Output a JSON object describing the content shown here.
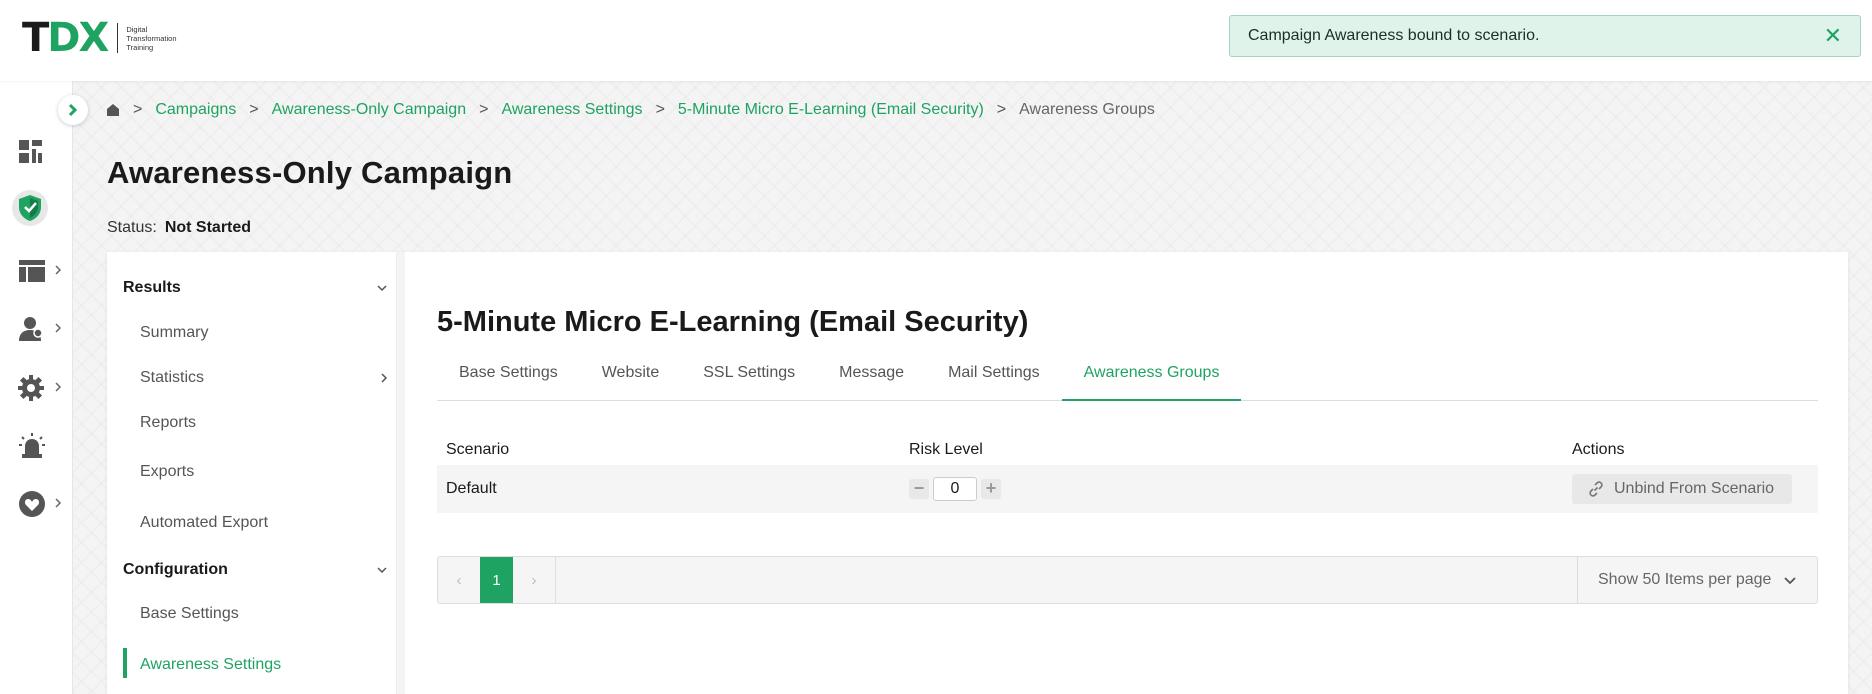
{
  "header": {
    "logo": {
      "mark_t": "T",
      "mark_dx": "DX",
      "subtitle": "Digital Transformation Training"
    },
    "toast": {
      "message": "Campaign Awareness bound to scenario.",
      "close_icon": "close-icon"
    }
  },
  "rail": {
    "items": [
      "dashboard-icon",
      "shield-icon",
      "layout-icon",
      "users-icon",
      "gear-icon",
      "alarm-icon",
      "heart-icon"
    ]
  },
  "breadcrumb": {
    "home_icon": "home-icon",
    "separator": ">",
    "items": [
      "Campaigns",
      "Awareness-Only Campaign",
      "Awareness Settings",
      "5-Minute Micro E-Learning (Email Security)",
      "Awareness Groups"
    ]
  },
  "page": {
    "title": "Awareness-Only Campaign",
    "status_label": "Status:",
    "status_value": "Not Started"
  },
  "subnav": {
    "results": "Results",
    "summary": "Summary",
    "statistics": "Statistics",
    "reports": "Reports",
    "exports": "Exports",
    "automated_export": "Automated Export",
    "configuration": "Configuration",
    "base_settings": "Base Settings",
    "awareness_settings": "Awareness Settings"
  },
  "main": {
    "title": "5-Minute Micro E-Learning (Email Security)",
    "tabs": [
      "Base Settings",
      "Website",
      "SSL Settings",
      "Message",
      "Mail Settings",
      "Awareness Groups"
    ],
    "active_tab": "Awareness Groups",
    "table": {
      "headers": {
        "scenario": "Scenario",
        "risk": "Risk Level",
        "actions": "Actions"
      },
      "rows": [
        {
          "scenario": "Default",
          "risk_level": "0",
          "action": "Unbind From Scenario"
        }
      ]
    },
    "pager": {
      "prev": "‹",
      "current_page": "1",
      "next": "›",
      "per_page": "Show 50 Items per page"
    }
  },
  "colors": {
    "accent": "#1fa362",
    "toast_bg": "#dff3ea"
  }
}
